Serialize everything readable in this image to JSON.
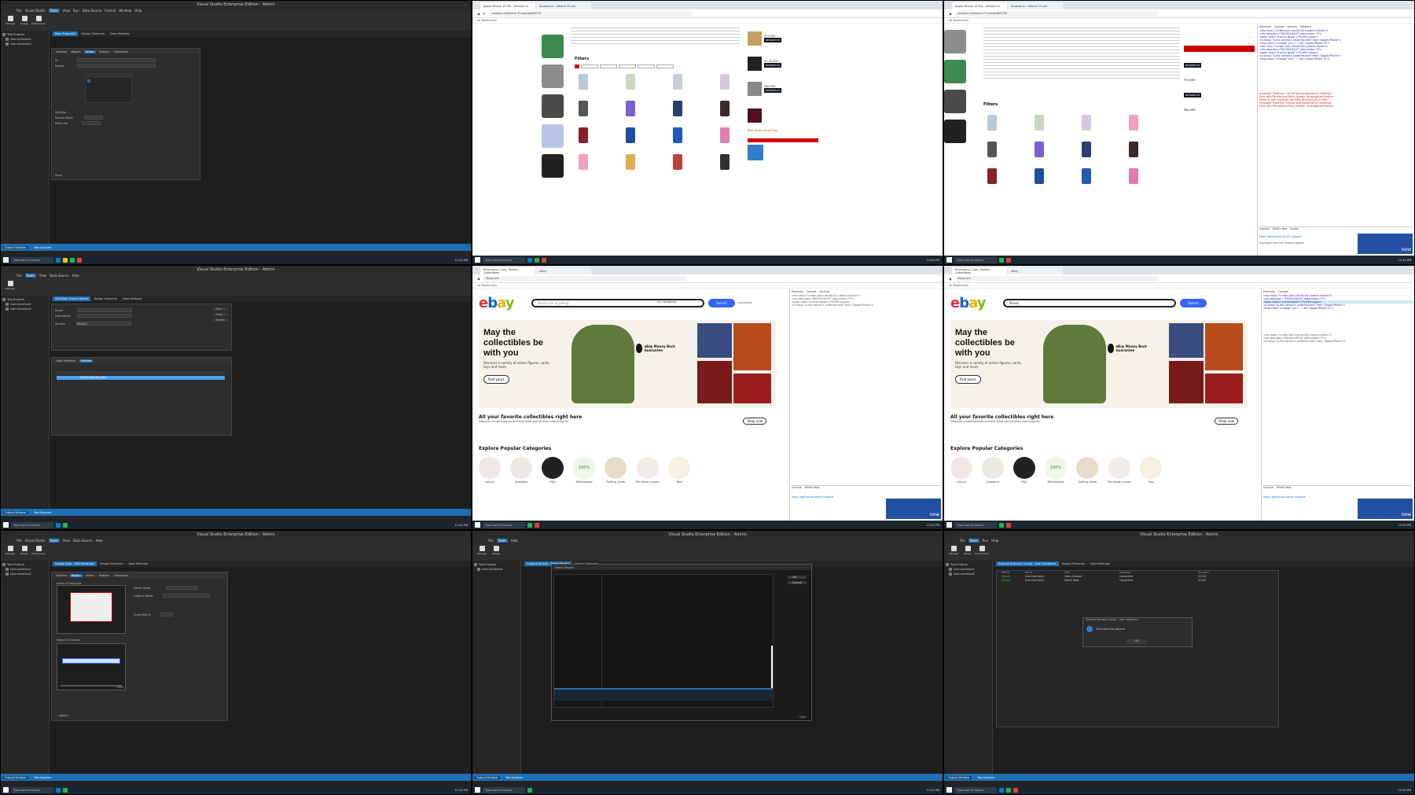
{
  "ide": {
    "window_title": "Visual Studio Enterprise Edition - Admin",
    "menu": [
      "File",
      "Visual Studio",
      "Tools",
      "View",
      "Run",
      "Data Source",
      "Tools",
      "Format",
      "Window",
      "Help"
    ],
    "menu_active": "Tools",
    "ribbon": [
      "Manage",
      "Design",
      "Preferences"
    ],
    "explorer_items": [
      "Test-Projects",
      "User-Interface1",
      "User-Interface2"
    ],
    "output_tabs": [
      "Output Window",
      "Test Explorer"
    ]
  },
  "panel1": {
    "doc_tabs": [
      "Main Program1",
      "Design Elements",
      "Data Methods"
    ],
    "dialog_tabs": [
      "General",
      "Region",
      "Action",
      "Options",
      "Advanced"
    ],
    "fields": [
      "ID",
      "Region"
    ],
    "section": "Settings",
    "rows": [
      "Search Mode",
      "Match By"
    ],
    "button": "Save"
  },
  "panel4": {
    "doc_tabs": [
      "Add Data Source Wizard",
      "Design Elements",
      "Data Methods"
    ],
    "fields": [
      "Name",
      "Description",
      "Version"
    ],
    "field_value": "Default",
    "side_buttons": [
      "New",
      "Save",
      "Delete"
    ],
    "subtabs": [
      "Data Selection",
      "Preview"
    ],
    "highlight": "Select Data Row Item"
  },
  "panel7": {
    "doc_tabs": [
      "Design Step - Edit Rectangle",
      "Design Elements",
      "Data Methods"
    ],
    "dialog_tabs": [
      "General",
      "Region",
      "Action",
      "Options",
      "Advanced"
    ],
    "sections": [
      "Action Of Rectangle",
      "Region Of Interest"
    ],
    "option_labels": [
      "Select Mode",
      "Capture Mode",
      "Scroll Within"
    ],
    "zoom": "100%",
    "button": "Save"
  },
  "panel8": {
    "doc_tabs": [
      "Capture Screen - Select Region",
      "Design Elements"
    ],
    "dialog_title": "Select Region",
    "buttons": [
      "OK",
      "Cancel"
    ],
    "zoom": "100%"
  },
  "panel9": {
    "doc_tabs": [
      "Execute Scenario (Local) - User Interface1",
      "Design Elements",
      "Data Methods"
    ],
    "columns": [
      "Status",
      "Name",
      "Step",
      "Message",
      "Duration"
    ],
    "rows": [
      {
        "status": "Passed",
        "name": "User-Interface1",
        "step": "Open Amazon",
        "message": "Completed",
        "duration": "0:0:00"
      },
      {
        "status": "Passed",
        "name": "User-Interface1",
        "step": "Select Data",
        "message": "Completed",
        "duration": "0:0:00"
      }
    ],
    "modal_title": "Execute Scenario (Local) - User Interface1",
    "modal_text": "Test case has passed",
    "modal_button": "OK"
  },
  "browser": {
    "tabs_amazon": [
      "Apple iPhone 15 Pro - Amazon.in",
      "Amazon.in : iphone 15 pro"
    ],
    "url_amazon": "amazon.in/iphone-15-pro/dp/B0CHX",
    "tabs_ebay": [
      "Electronics, Cars, Fashion, Collectibles",
      "eBay"
    ],
    "url_ebay": "ebay.com",
    "bookmarks": "All Bookmarks"
  },
  "amazon": {
    "filters_label": "Filters",
    "buy_label": "Buy Now",
    "brand": "amazon.in",
    "price1": "₹79,999",
    "price2": "₹1,29,900",
    "price3": "₹64,999",
    "deal": "Best Deals of the Day"
  },
  "ebay": {
    "search_placeholder": "Search for anything",
    "search_value": "Shoes",
    "category": "All Categories",
    "search_button": "Search",
    "advanced": "Advanced",
    "hero_title": "May the collectibles be with you",
    "hero_sub": "Discover a variety of action figures, cards, toys and more.",
    "hero_cta": "Find yours",
    "money_back": "eBay Money Back Guarantee",
    "banner_title": "All your favorite collectibles right here",
    "banner_sub": "Discover curated pieces and find what you've been searching for.",
    "banner_cta": "Shop now",
    "explore": "Explore Popular Categories",
    "categories": [
      "Luxury",
      "Sneakers",
      "P&A",
      "Refurbished",
      "Trading Cards",
      "Pre-loved Luxury",
      "Toys"
    ],
    "refurb_badge": "100%",
    "refurb_text": "Refurbished"
  },
  "devtools": {
    "tabs": [
      "Elements",
      "Console",
      "Sources",
      "Network"
    ],
    "lines_blue": [
      "<div class=\"s-main-slot s-result-list s-search-results\">",
      "<div data-asin=\"B0CHX1W1XY\" data-index=\"3\">",
      "<span class=\"a-price-whole\">79,999</span>",
      "<a class=\"a-link-normal s-underline-text\" href=\"/Apple-iPhone\">",
      "<img class=\"s-image\" src=\"...\" alt=\"Apple iPhone 15\">"
    ],
    "lines_red": [
      "Uncaught TypeError: Cannot read properties of undefined",
      "Error with Permissions-Policy header: Unrecognized feature",
      "Failed to load resource: net::ERR_BLOCKED_BY_CLIENT"
    ],
    "drawer_tabs": [
      "Console",
      "What's New",
      "Issues"
    ],
    "whats_new": "New Lighthouse panel support",
    "highlights": "Highlights from the Chrome update",
    "new_badge": "new"
  },
  "taskbar": {
    "search": "Type here to search",
    "clock": "12:40 PM"
  },
  "colors": {
    "ide_bg": "#232323",
    "ide_accent": "#1f6fb5",
    "taskbar": "#1c2630",
    "ebay_blue": "#3665f3",
    "amazon_orange": "#f7a21b"
  }
}
